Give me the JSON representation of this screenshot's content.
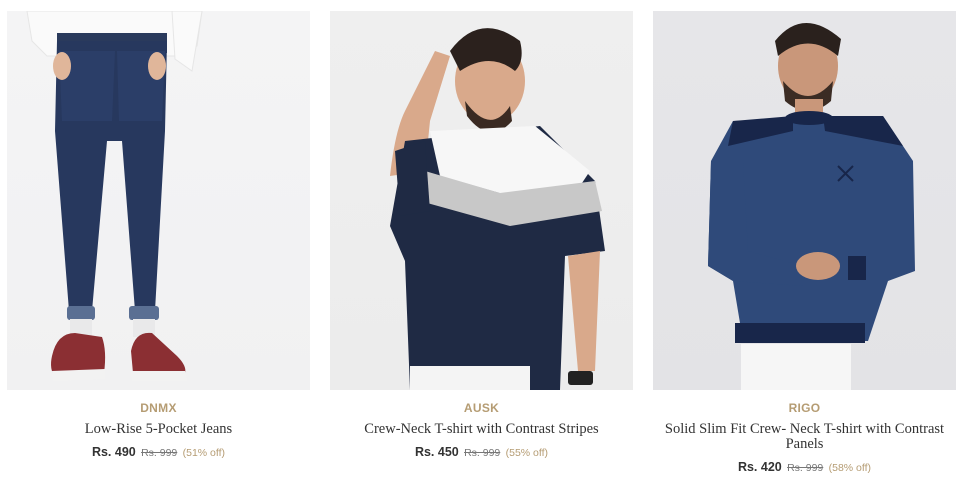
{
  "products": [
    {
      "brand": "DNMX",
      "title": "Low-Rise 5-Pocket Jeans",
      "price": "Rs. 490",
      "mrp": "Rs. 999",
      "discount": "(51% off)"
    },
    {
      "brand": "AUSK",
      "title": "Crew-Neck T-shirt with Contrast Stripes",
      "price": "Rs. 450",
      "mrp": "Rs. 999",
      "discount": "(55% off)"
    },
    {
      "brand": "RIGO",
      "title": "Solid Slim Fit Crew- Neck T-shirt with Contrast Panels",
      "price": "Rs. 420",
      "mrp": "Rs. 999",
      "discount": "(58% off)"
    }
  ],
  "colors": {
    "brand_accent": "#b59c73",
    "title_text": "#333333",
    "strike_price": "#777777"
  }
}
